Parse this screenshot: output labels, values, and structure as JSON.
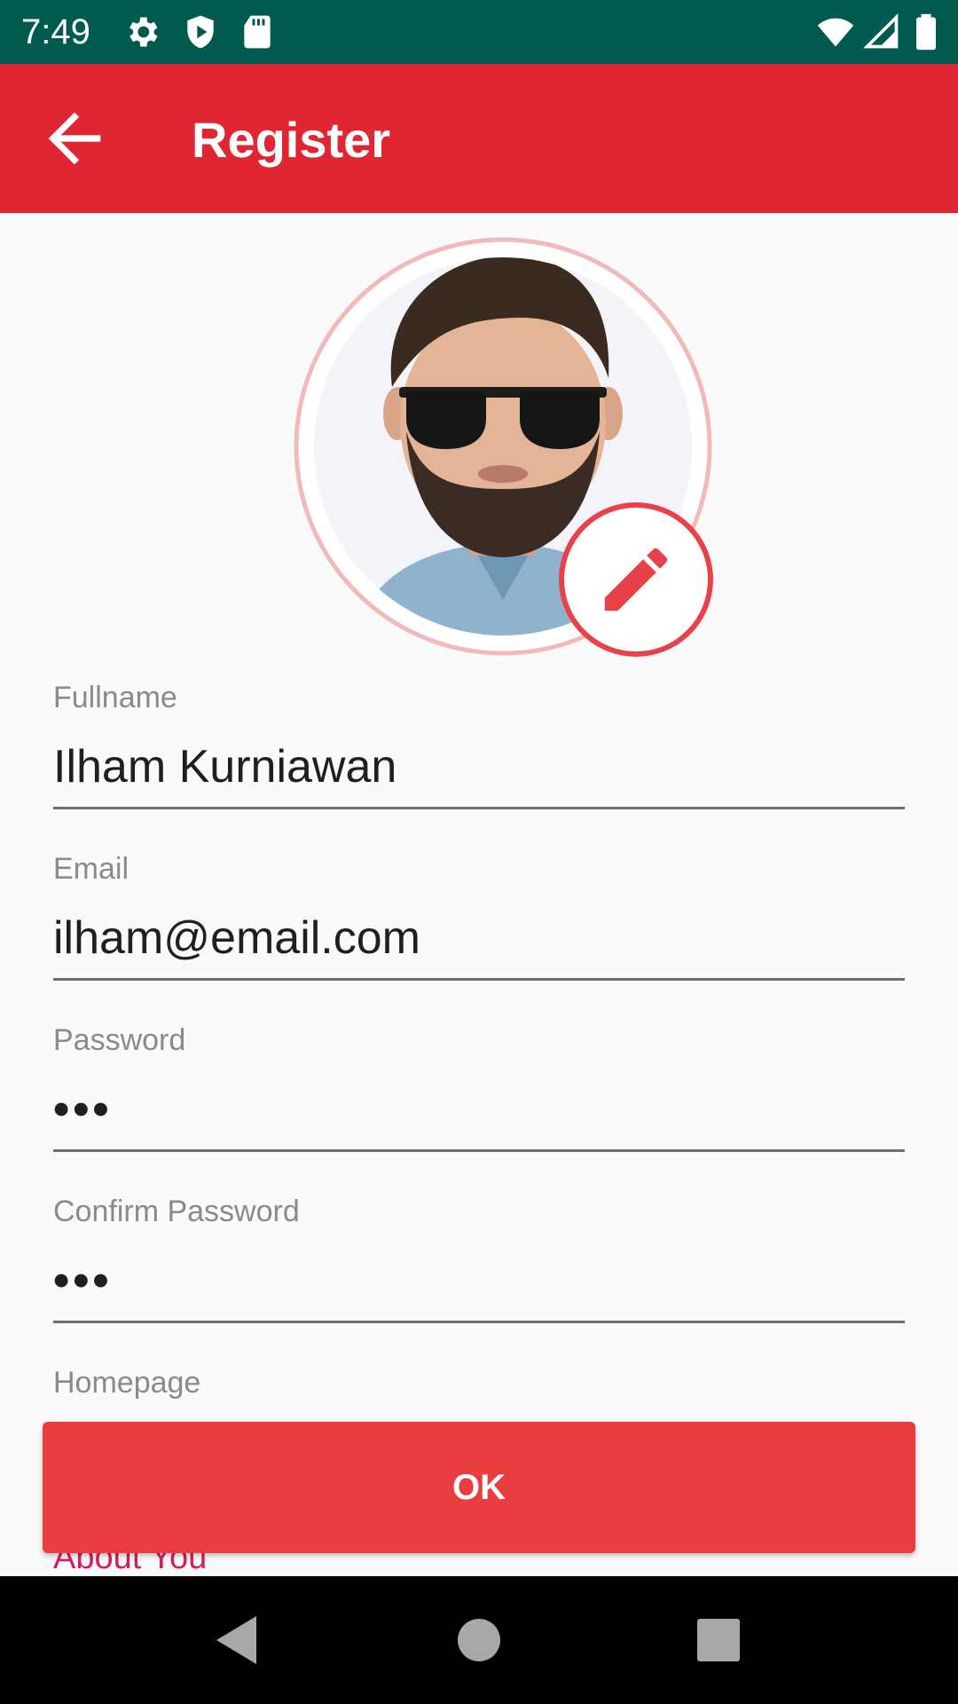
{
  "status_bar": {
    "time": "7:49",
    "icons": [
      "gear-icon",
      "play-protect-icon",
      "sd-card-icon",
      "wifi-icon",
      "signal-icon",
      "battery-icon"
    ]
  },
  "app_bar": {
    "title": "Register",
    "back_icon": "arrow-back-icon"
  },
  "avatar": {
    "edit_icon": "pencil-icon"
  },
  "form": {
    "fullname": {
      "label": "Fullname",
      "value": "Ilham Kurniawan"
    },
    "email": {
      "label": "Email",
      "value": "ilham@email.com"
    },
    "password": {
      "label": "Password",
      "value": "•••"
    },
    "confirm_password": {
      "label": "Confirm Password",
      "value": "•••"
    },
    "homepage": {
      "label": "Homepage"
    },
    "about": {
      "label": "About You"
    }
  },
  "ok_button": {
    "label": "OK"
  },
  "colors": {
    "status_bar": "#005a4f",
    "app_bar": "#e02632",
    "accent": "#e83e40",
    "about_label": "#d81b60"
  },
  "nav_bar": {
    "icons": [
      "back-triangle-icon",
      "home-circle-icon",
      "recents-square-icon"
    ]
  }
}
